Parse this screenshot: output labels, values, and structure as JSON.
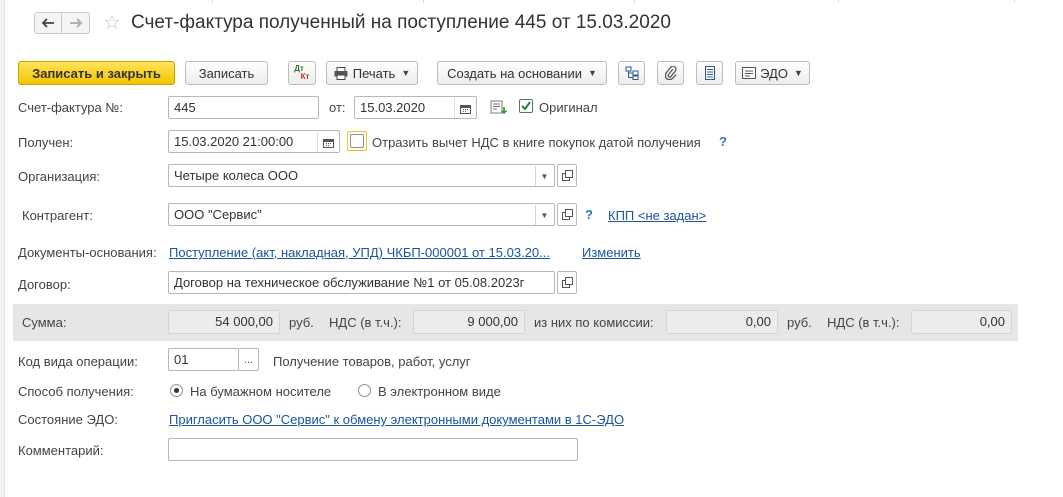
{
  "header": {
    "title": "Счет-фактура полученный на поступление 445 от 15.03.2020",
    "back_icon": "arrow-left-icon",
    "forward_icon": "arrow-right-icon",
    "favorite_icon": "star-icon"
  },
  "toolbar": {
    "save_close_label": "Записать и закрыть",
    "save_label": "Записать",
    "dtkt_top": "Дт",
    "dtkt_bottom": "Кт",
    "print_label": "Печать",
    "create_based_label": "Создать на основании",
    "edo_label": "ЭДО"
  },
  "form": {
    "invoice_label": "Счет-фактура №:",
    "invoice_number": "445",
    "from_label": "от:",
    "invoice_date": "15.03.2020",
    "original_label": "Оригинал",
    "original_checked": true,
    "received_label": "Получен:",
    "received_datetime": "15.03.2020 21:00:00",
    "vat_deduction_label": "Отразить вычет НДС в книге покупок датой получения",
    "vat_deduction_checked": false,
    "help_mark": "?",
    "org_label": "Организация:",
    "org_value": "Четыре колеса ООО",
    "counterparty_label": "Контрагент:",
    "counterparty_value": "ООО \"Сервис\"",
    "kpp_link": "КПП <не задан>",
    "base_docs_label": "Документы-основания:",
    "base_docs_link": "Поступление (акт, накладная, УПД) ЧКБП-000001 от 15.03.20...",
    "change_link": "Изменить",
    "contract_label": "Договор:",
    "contract_value": "Договор на техническое обслуживание  №1 от 05.08.2023г",
    "op_code_label": "Код вида операции:",
    "op_code_value": "01",
    "op_code_btn": "...",
    "op_code_desc": "Получение товаров, работ, услуг",
    "method_label": "Способ получения:",
    "method_paper": "На бумажном носителе",
    "method_electronic": "В электронном виде",
    "method_selected": "paper",
    "edo_state_label": "Состояние ЭДО:",
    "edo_state_link": "Пригласить ООО \"Сервис\" к обмену электронными документами в 1С-ЭДО",
    "comment_label": "Комментарий:",
    "comment_value": ""
  },
  "sums": {
    "sum_label": "Сумма:",
    "sum_value": "54 000,00",
    "currency1": "руб.",
    "vat_label1": "НДС (в т.ч.):",
    "vat_value1": "9 000,00",
    "commission_label": "из них по комиссии:",
    "commission_value": "0,00",
    "currency2": "руб.",
    "vat_label2": "НДС (в т.ч.):",
    "vat_value2": "0,00"
  },
  "colors": {
    "primary_button": "#f4c400",
    "link": "#1a55a0",
    "band": "#e6e6e6"
  }
}
